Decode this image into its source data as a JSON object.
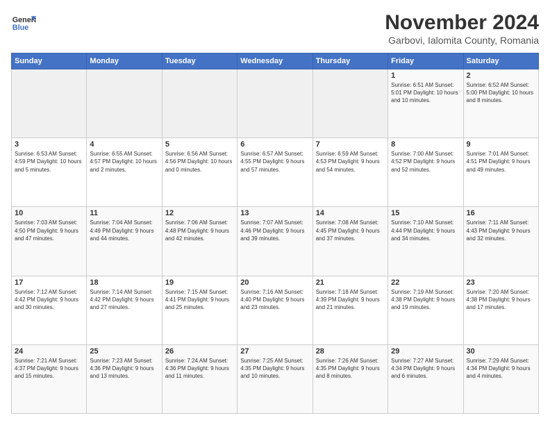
{
  "logo": {
    "line1": "General",
    "line2": "Blue"
  },
  "header": {
    "month": "November 2024",
    "location": "Garbovi, Ialomita County, Romania"
  },
  "days_of_week": [
    "Sunday",
    "Monday",
    "Tuesday",
    "Wednesday",
    "Thursday",
    "Friday",
    "Saturday"
  ],
  "weeks": [
    [
      {
        "day": "",
        "info": ""
      },
      {
        "day": "",
        "info": ""
      },
      {
        "day": "",
        "info": ""
      },
      {
        "day": "",
        "info": ""
      },
      {
        "day": "",
        "info": ""
      },
      {
        "day": "1",
        "info": "Sunrise: 6:51 AM\nSunset: 5:01 PM\nDaylight: 10 hours and 10 minutes."
      },
      {
        "day": "2",
        "info": "Sunrise: 6:52 AM\nSunset: 5:00 PM\nDaylight: 10 hours and 8 minutes."
      }
    ],
    [
      {
        "day": "3",
        "info": "Sunrise: 6:53 AM\nSunset: 4:59 PM\nDaylight: 10 hours and 5 minutes."
      },
      {
        "day": "4",
        "info": "Sunrise: 6:55 AM\nSunset: 4:57 PM\nDaylight: 10 hours and 2 minutes."
      },
      {
        "day": "5",
        "info": "Sunrise: 6:56 AM\nSunset: 4:56 PM\nDaylight: 10 hours and 0 minutes."
      },
      {
        "day": "6",
        "info": "Sunrise: 6:57 AM\nSunset: 4:55 PM\nDaylight: 9 hours and 57 minutes."
      },
      {
        "day": "7",
        "info": "Sunrise: 6:59 AM\nSunset: 4:53 PM\nDaylight: 9 hours and 54 minutes."
      },
      {
        "day": "8",
        "info": "Sunrise: 7:00 AM\nSunset: 4:52 PM\nDaylight: 9 hours and 52 minutes."
      },
      {
        "day": "9",
        "info": "Sunrise: 7:01 AM\nSunset: 4:51 PM\nDaylight: 9 hours and 49 minutes."
      }
    ],
    [
      {
        "day": "10",
        "info": "Sunrise: 7:03 AM\nSunset: 4:50 PM\nDaylight: 9 hours and 47 minutes."
      },
      {
        "day": "11",
        "info": "Sunrise: 7:04 AM\nSunset: 4:49 PM\nDaylight: 9 hours and 44 minutes."
      },
      {
        "day": "12",
        "info": "Sunrise: 7:06 AM\nSunset: 4:48 PM\nDaylight: 9 hours and 42 minutes."
      },
      {
        "day": "13",
        "info": "Sunrise: 7:07 AM\nSunset: 4:46 PM\nDaylight: 9 hours and 39 minutes."
      },
      {
        "day": "14",
        "info": "Sunrise: 7:08 AM\nSunset: 4:45 PM\nDaylight: 9 hours and 37 minutes."
      },
      {
        "day": "15",
        "info": "Sunrise: 7:10 AM\nSunset: 4:44 PM\nDaylight: 9 hours and 34 minutes."
      },
      {
        "day": "16",
        "info": "Sunrise: 7:11 AM\nSunset: 4:43 PM\nDaylight: 9 hours and 32 minutes."
      }
    ],
    [
      {
        "day": "17",
        "info": "Sunrise: 7:12 AM\nSunset: 4:42 PM\nDaylight: 9 hours and 30 minutes."
      },
      {
        "day": "18",
        "info": "Sunrise: 7:14 AM\nSunset: 4:42 PM\nDaylight: 9 hours and 27 minutes."
      },
      {
        "day": "19",
        "info": "Sunrise: 7:15 AM\nSunset: 4:41 PM\nDaylight: 9 hours and 25 minutes."
      },
      {
        "day": "20",
        "info": "Sunrise: 7:16 AM\nSunset: 4:40 PM\nDaylight: 9 hours and 23 minutes."
      },
      {
        "day": "21",
        "info": "Sunrise: 7:18 AM\nSunset: 4:39 PM\nDaylight: 9 hours and 21 minutes."
      },
      {
        "day": "22",
        "info": "Sunrise: 7:19 AM\nSunset: 4:38 PM\nDaylight: 9 hours and 19 minutes."
      },
      {
        "day": "23",
        "info": "Sunrise: 7:20 AM\nSunset: 4:38 PM\nDaylight: 9 hours and 17 minutes."
      }
    ],
    [
      {
        "day": "24",
        "info": "Sunrise: 7:21 AM\nSunset: 4:37 PM\nDaylight: 9 hours and 15 minutes."
      },
      {
        "day": "25",
        "info": "Sunrise: 7:23 AM\nSunset: 4:36 PM\nDaylight: 9 hours and 13 minutes."
      },
      {
        "day": "26",
        "info": "Sunrise: 7:24 AM\nSunset: 4:36 PM\nDaylight: 9 hours and 11 minutes."
      },
      {
        "day": "27",
        "info": "Sunrise: 7:25 AM\nSunset: 4:35 PM\nDaylight: 9 hours and 10 minutes."
      },
      {
        "day": "28",
        "info": "Sunrise: 7:26 AM\nSunset: 4:35 PM\nDaylight: 9 hours and 8 minutes."
      },
      {
        "day": "29",
        "info": "Sunrise: 7:27 AM\nSunset: 4:34 PM\nDaylight: 9 hours and 6 minutes."
      },
      {
        "day": "30",
        "info": "Sunrise: 7:29 AM\nSunset: 4:34 PM\nDaylight: 9 hours and 4 minutes."
      }
    ]
  ]
}
